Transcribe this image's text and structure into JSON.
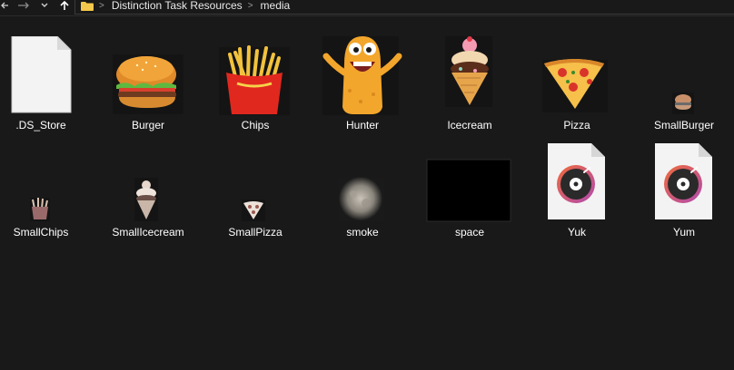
{
  "breadcrumb": {
    "segments": [
      "Distinction Task Resources",
      "media"
    ]
  },
  "nav": {
    "back_icon": "arrow-left-icon",
    "forward_icon": "arrow-right-icon",
    "recent_icon": "chevron-down-icon",
    "up_icon": "arrow-up-icon",
    "folder_icon": "folder-icon"
  },
  "colors": {
    "background": "#191919",
    "text": "#ffffff",
    "folder": "#f4c84a"
  },
  "files": [
    {
      "name": ".DS_Store",
      "icon": "blank-document-icon"
    },
    {
      "name": "Burger",
      "icon": "burger-image-icon"
    },
    {
      "name": "Chips",
      "icon": "chips-image-icon"
    },
    {
      "name": "Hunter",
      "icon": "monster-image-icon"
    },
    {
      "name": "Icecream",
      "icon": "icecream-image-icon"
    },
    {
      "name": "Pizza",
      "icon": "pizza-image-icon"
    },
    {
      "name": "SmallBurger",
      "icon": "small-burger-image-icon"
    },
    {
      "name": "SmallChips",
      "icon": "small-chips-image-icon"
    },
    {
      "name": "SmallIcecream",
      "icon": "small-icecream-image-icon"
    },
    {
      "name": "SmallPizza",
      "icon": "small-pizza-image-icon"
    },
    {
      "name": "smoke",
      "icon": "smoke-image-icon"
    },
    {
      "name": "space",
      "icon": "black-image-icon"
    },
    {
      "name": "Yuk",
      "icon": "audio-file-icon"
    },
    {
      "name": "Yum",
      "icon": "audio-file-icon"
    }
  ]
}
